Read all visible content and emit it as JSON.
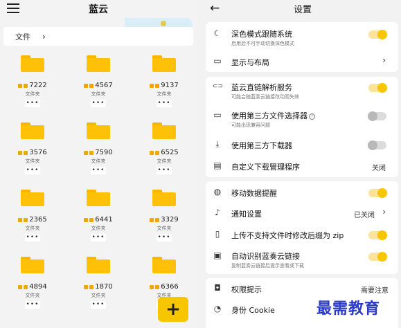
{
  "left": {
    "title": "蓝云",
    "breadcrumb": {
      "label": "文件",
      "chevron": "›"
    },
    "folders": [
      {
        "name": "7222",
        "type": "文件夹"
      },
      {
        "name": "4567",
        "type": "文件夹"
      },
      {
        "name": "9137",
        "type": "文件夹"
      },
      {
        "name": "3576",
        "type": "文件夹"
      },
      {
        "name": "7590",
        "type": "文件夹"
      },
      {
        "name": "6525",
        "type": "文件夹"
      },
      {
        "name": "2365",
        "type": "文件夹"
      },
      {
        "name": "6441",
        "type": "文件夹"
      },
      {
        "name": "3329",
        "type": "文件夹"
      },
      {
        "name": "4894",
        "type": "文件夹"
      },
      {
        "name": "1870",
        "type": "文件夹"
      },
      {
        "name": "6366",
        "type": "文件夹"
      }
    ],
    "more_label": "•••",
    "fab_label": "+"
  },
  "right": {
    "back": "←",
    "title": "设置",
    "items": [
      {
        "label": "深色模式跟随系统",
        "sub": "启用后不可手动切换深色模式",
        "toggle": "on",
        "icon": "moon-icon",
        "glyph": "☾"
      },
      {
        "label": "显示与布局",
        "chevron": "›",
        "icon": "monitor-icon",
        "glyph": "▭"
      },
      {
        "label": "蓝云直链解析服务",
        "sub": "可能会随蓝奏云链接改动而失效",
        "toggle": "on",
        "icon": "link-icon",
        "glyph": "⊂⊃"
      },
      {
        "label": "使用第三方文件选择器",
        "sub": "可能出现兼容问题",
        "toggle": "off",
        "icon": "folder-icon",
        "glyph": "▭",
        "help": "?"
      },
      {
        "label": "使用第三方下载器",
        "toggle": "off",
        "icon": "download-icon",
        "glyph": "⤓"
      },
      {
        "label": "自定义下载管理程序",
        "value": "关闭",
        "icon": "terminal-icon",
        "glyph": "▤"
      },
      {
        "label": "移动数据提醒",
        "toggle": "on",
        "icon": "globe-icon",
        "glyph": "◍"
      },
      {
        "label": "通知设置",
        "value": "已关闭",
        "chevron": "›",
        "icon": "bell-icon",
        "glyph": "♪"
      },
      {
        "label": "上传不支持文件时修改后缀为 zip",
        "toggle": "on",
        "icon": "file-icon",
        "glyph": "▯"
      },
      {
        "label": "自动识别蓝奏云链接",
        "sub": "复制蓝奏云链接后提示查看或下载",
        "toggle": "on",
        "icon": "clipboard-icon",
        "glyph": "▣"
      },
      {
        "label": "权限提示",
        "value": "需要注意",
        "icon": "lock-icon",
        "glyph": "◘"
      },
      {
        "label": "身份 Cookie",
        "icon": "cookie-icon",
        "glyph": "◔"
      }
    ]
  },
  "watermark": "最需教育",
  "colors": {
    "accent": "#f7c600",
    "folder": "#ffc107",
    "watermark": "#2b3bc8"
  }
}
